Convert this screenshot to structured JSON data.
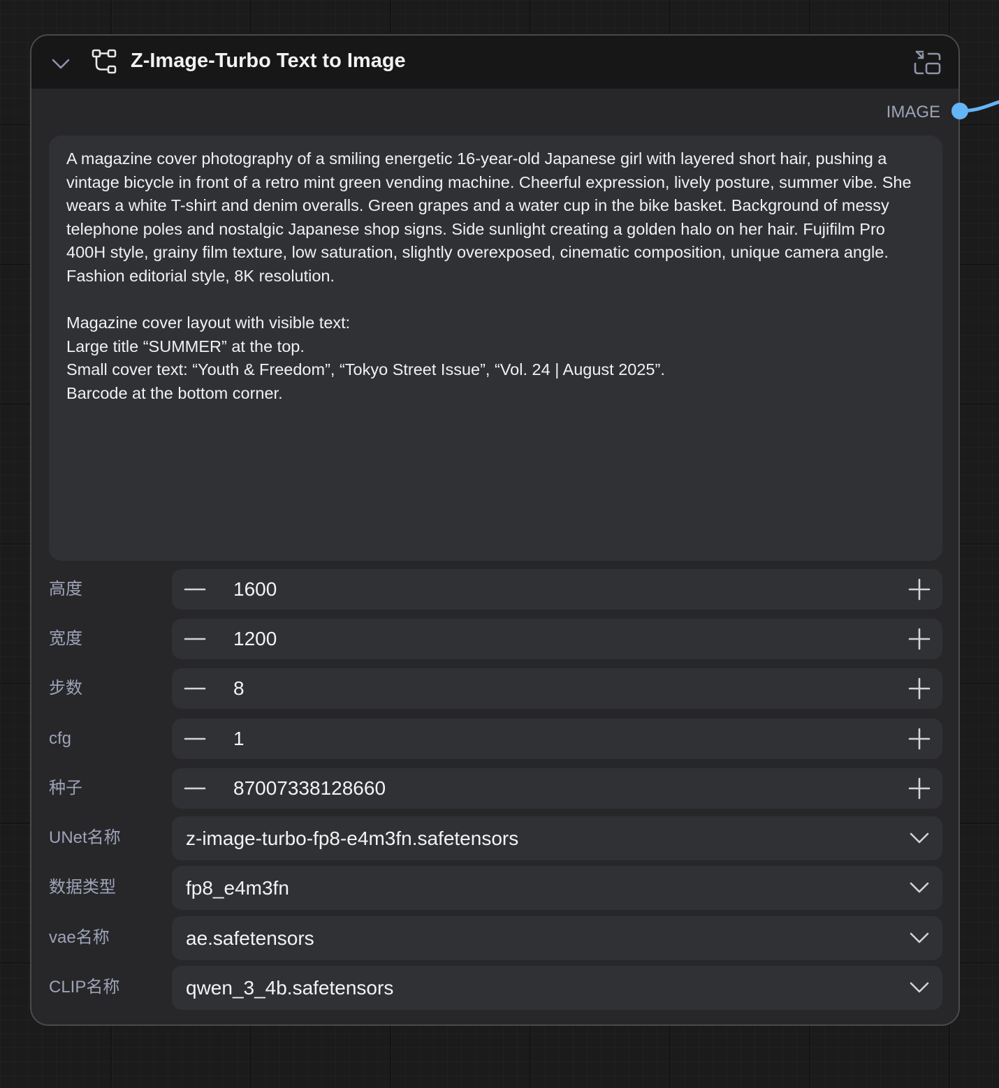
{
  "node": {
    "title": "Z-Image-Turbo Text to Image",
    "output": {
      "label": "IMAGE",
      "color": "#64b5f6"
    },
    "prompt": "A magazine cover photography of a smiling energetic 16-year-old Japanese girl with layered short hair, pushing a vintage bicycle in front of a retro mint green vending machine. Cheerful expression, lively posture, summer vibe. She wears a white T-shirt and denim overalls. Green grapes and a water cup in the bike basket. Background of messy telephone poles and nostalgic Japanese shop signs. Side sunlight creating a golden halo on her hair. Fujifilm Pro 400H style, grainy film texture, low saturation, slightly overexposed, cinematic composition, unique camera angle. Fashion editorial style, 8K resolution.\n\nMagazine cover layout with visible text:\nLarge title “SUMMER” at the top.\nSmall cover text: “Youth & Freedom”, “Tokyo Street Issue”, “Vol. 24 | August 2025”.\nBarcode at the bottom corner.",
    "widgets": [
      {
        "label": "高度",
        "value": "1600",
        "type": "number"
      },
      {
        "label": "宽度",
        "value": "1200",
        "type": "number"
      },
      {
        "label": "步数",
        "value": "8",
        "type": "number"
      },
      {
        "label": "cfg",
        "value": "1",
        "type": "number"
      },
      {
        "label": "种子",
        "value": "87007338128660",
        "type": "number"
      },
      {
        "label": "UNet名称",
        "value": "z-image-turbo-fp8-e4m3fn.safetensors",
        "type": "combo"
      },
      {
        "label": "数据类型",
        "value": "fp8_e4m3fn",
        "type": "combo"
      },
      {
        "label": "vae名称",
        "value": "ae.safetensors",
        "type": "combo"
      },
      {
        "label": "CLIP名称",
        "value": "qwen_3_4b.safetensors",
        "type": "combo"
      }
    ]
  },
  "icons": {
    "collapse": "chevron-down-icon",
    "subgraph": "subgraph-icon",
    "enter_subgraph": "enter-subgraph-icon",
    "decrement": "minus-icon",
    "increment": "plus-icon",
    "dropdown": "chevron-down-icon"
  },
  "colors": {
    "canvas": "#1b1b1c",
    "node_body": "#272729",
    "node_header": "#171718",
    "widget_bg": "#303135",
    "label": "#9ea3b8",
    "link": "#64b5f6"
  }
}
